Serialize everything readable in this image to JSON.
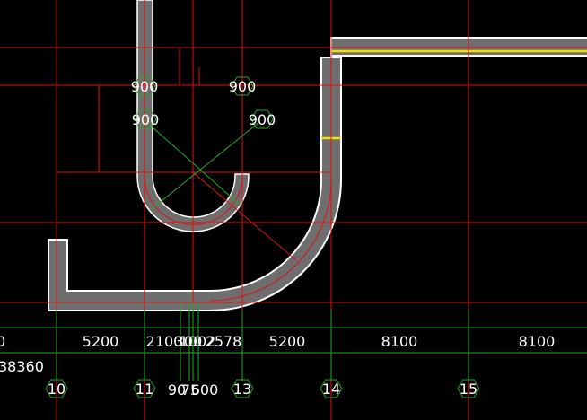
{
  "drawing": {
    "colors": {
      "background": "#000000",
      "axis": "#e01010",
      "dimension": "#22aa22",
      "wall_fill": "#6e6e6e",
      "wall_edge": "#ffffff",
      "highlight": "#f2e000",
      "text": "#ffffff"
    },
    "elevation_marks": {
      "a": "900",
      "b": "900",
      "c": "900",
      "d": "900"
    },
    "dimensions": {
      "left_partial": "0",
      "d1": "5200",
      "d2": "2100",
      "d3": "300",
      "d4": "1002",
      "d5": "2578",
      "d6": "5200",
      "d7": "8100",
      "d8": "8100",
      "overall": "38360",
      "lower_a": "90",
      "lower_b": "75",
      "lower_c": "600"
    },
    "axis_labels": {
      "a10": "10",
      "a11": "11",
      "a13": "13",
      "a14": "14",
      "a15": "15"
    }
  }
}
